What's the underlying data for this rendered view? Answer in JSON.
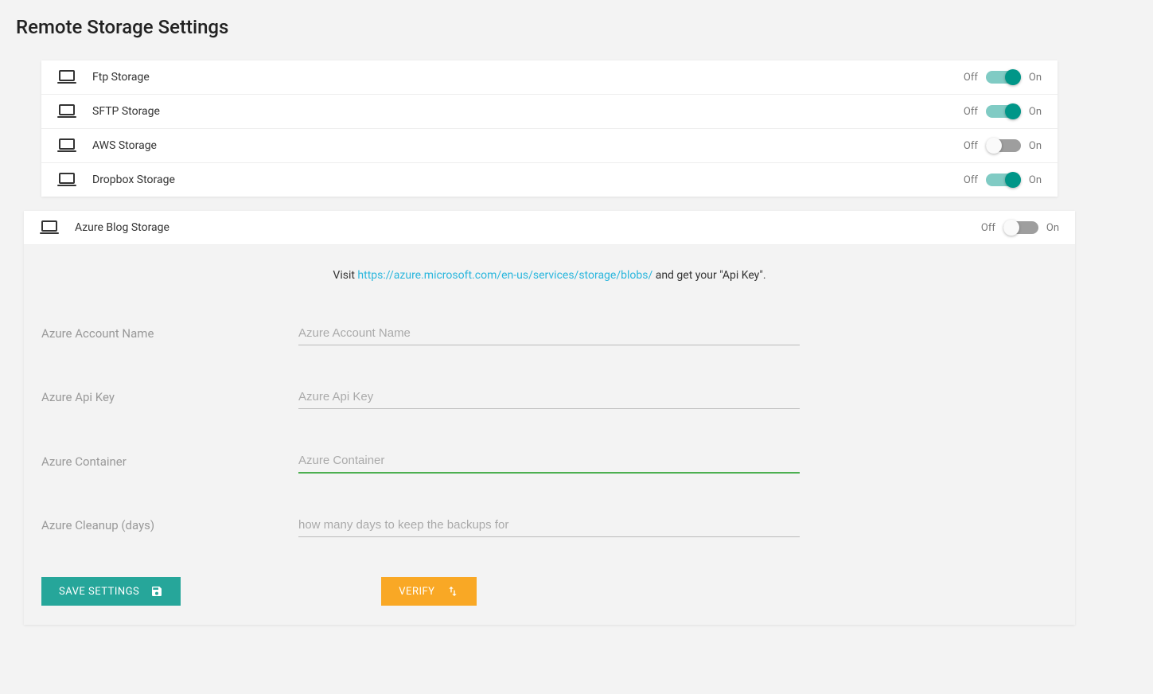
{
  "title": "Remote Storage Settings",
  "toggle": {
    "off": "Off",
    "on": "On"
  },
  "storages": [
    {
      "label": "Ftp Storage",
      "on": true
    },
    {
      "label": "SFTP Storage",
      "on": true
    },
    {
      "label": "AWS Storage",
      "on": false
    },
    {
      "label": "Dropbox Storage",
      "on": true
    }
  ],
  "expanded": {
    "label": "Azure Blog Storage",
    "on": false,
    "hint_prefix": "Visit ",
    "hint_link": "https://azure.microsoft.com/en-us/services/storage/blobs/",
    "hint_suffix": " and get your \"Api Key\".",
    "fields": [
      {
        "label": "Azure Account Name",
        "placeholder": "Azure Account Name",
        "focused": false
      },
      {
        "label": "Azure Api Key",
        "placeholder": "Azure Api Key",
        "focused": false
      },
      {
        "label": "Azure Container",
        "placeholder": "Azure Container",
        "focused": true
      },
      {
        "label": "Azure Cleanup (days)",
        "placeholder": "how many days to keep the backups for",
        "focused": false
      }
    ],
    "save_label": "Save Settings",
    "verify_label": "Verify"
  }
}
